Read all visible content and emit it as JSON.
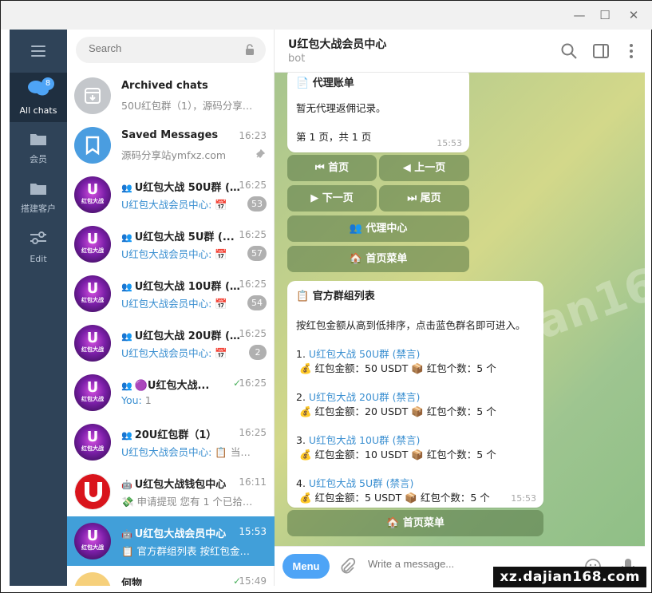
{
  "window": {
    "minimize": "—",
    "maximize": "☐",
    "close": "✕"
  },
  "rail": {
    "all_chats_label": "All chats",
    "all_chats_badge": "8",
    "members_label": "会员",
    "build_label": "搭建客户",
    "edit_label": "Edit"
  },
  "search": {
    "placeholder": "Search"
  },
  "chats": [
    {
      "name": "Archived chats",
      "time": "",
      "preview": "50U红包群（1），源码分享站...",
      "count": ""
    },
    {
      "name": "Saved Messages",
      "time": "16:23",
      "preview": "源码分享站ymfxz.com",
      "count": ""
    },
    {
      "name": "U红包大战 50U群 (...",
      "time": "16:25",
      "preview_sender": "U红包大战会员中心:",
      "preview": " 📅",
      "count": "53"
    },
    {
      "name": "U红包大战 5U群 (...",
      "time": "16:25",
      "preview_sender": "U红包大战会员中心:",
      "preview": " 📅",
      "count": "57"
    },
    {
      "name": "U红包大战 10U群 (...",
      "time": "16:25",
      "preview_sender": "U红包大战会员中心:",
      "preview": " 📅",
      "count": "54"
    },
    {
      "name": "U红包大战 20U群 (...",
      "time": "16:25",
      "preview_sender": "U红包大战会员中心:",
      "preview": " 📅",
      "count": "2"
    },
    {
      "name": "🟣U红包大战...",
      "time": "16:25",
      "preview_sender": "You:",
      "preview": " 1",
      "count": ""
    },
    {
      "name": "20U红包群（1）",
      "time": "16:25",
      "preview_sender": "U红包大战会员中心:",
      "preview": " 📋 当前...",
      "count": ""
    },
    {
      "name": "U红包大战钱包中心",
      "time": "16:11",
      "preview": "💸 申请提现  您有 1 个已拾红...",
      "count": ""
    },
    {
      "name": "U红包大战会员中心",
      "time": "15:53",
      "preview": "📋 官方群组列表  按红包金额...",
      "count": ""
    },
    {
      "name": "何物",
      "time": "15:49",
      "preview": "",
      "count": ""
    }
  ],
  "avatar_text": {
    "game": "红包大战",
    "letter": "U"
  },
  "header": {
    "title": "U红包大战会员中心",
    "subtitle": "bot"
  },
  "messages": {
    "agent": {
      "title": "📄 代理账单",
      "body": "暂无代理返佣记录。",
      "page": "第 1 页，共 1 页",
      "time": "15:53"
    },
    "agent_buttons": [
      "⏮ 首页",
      "◀ 上一页",
      "▶ 下一页",
      "⏭ 尾页",
      "👥 代理中心",
      "🏠 首页菜单"
    ],
    "groups": {
      "title": "📋 官方群组列表",
      "intro": "按红包金额从高到低排序，点击蓝色群名即可进入。",
      "items": [
        {
          "num": "1.",
          "name": "U红包大战 50U群 (禁言)",
          "detail": "💰 红包金额：50 USDT 📦 红包个数：5 个"
        },
        {
          "num": "2.",
          "name": "U红包大战 20U群 (禁言)",
          "detail": "💰 红包金额：20 USDT 📦 红包个数：5 个"
        },
        {
          "num": "3.",
          "name": "U红包大战 10U群 (禁言)",
          "detail": "💰 红包金额：10 USDT 📦 红包个数：5 个"
        },
        {
          "num": "4.",
          "name": "U红包大战 5U群 (禁言)",
          "detail": "💰 红包金额：5 USDT 📦 红包个数：5 个"
        }
      ],
      "time": "15:53"
    },
    "groups_button": "🏠 首页菜单"
  },
  "composer": {
    "menu_label": "Menu",
    "placeholder": "Write a message..."
  },
  "watermark": "xz.dajian168.com"
}
